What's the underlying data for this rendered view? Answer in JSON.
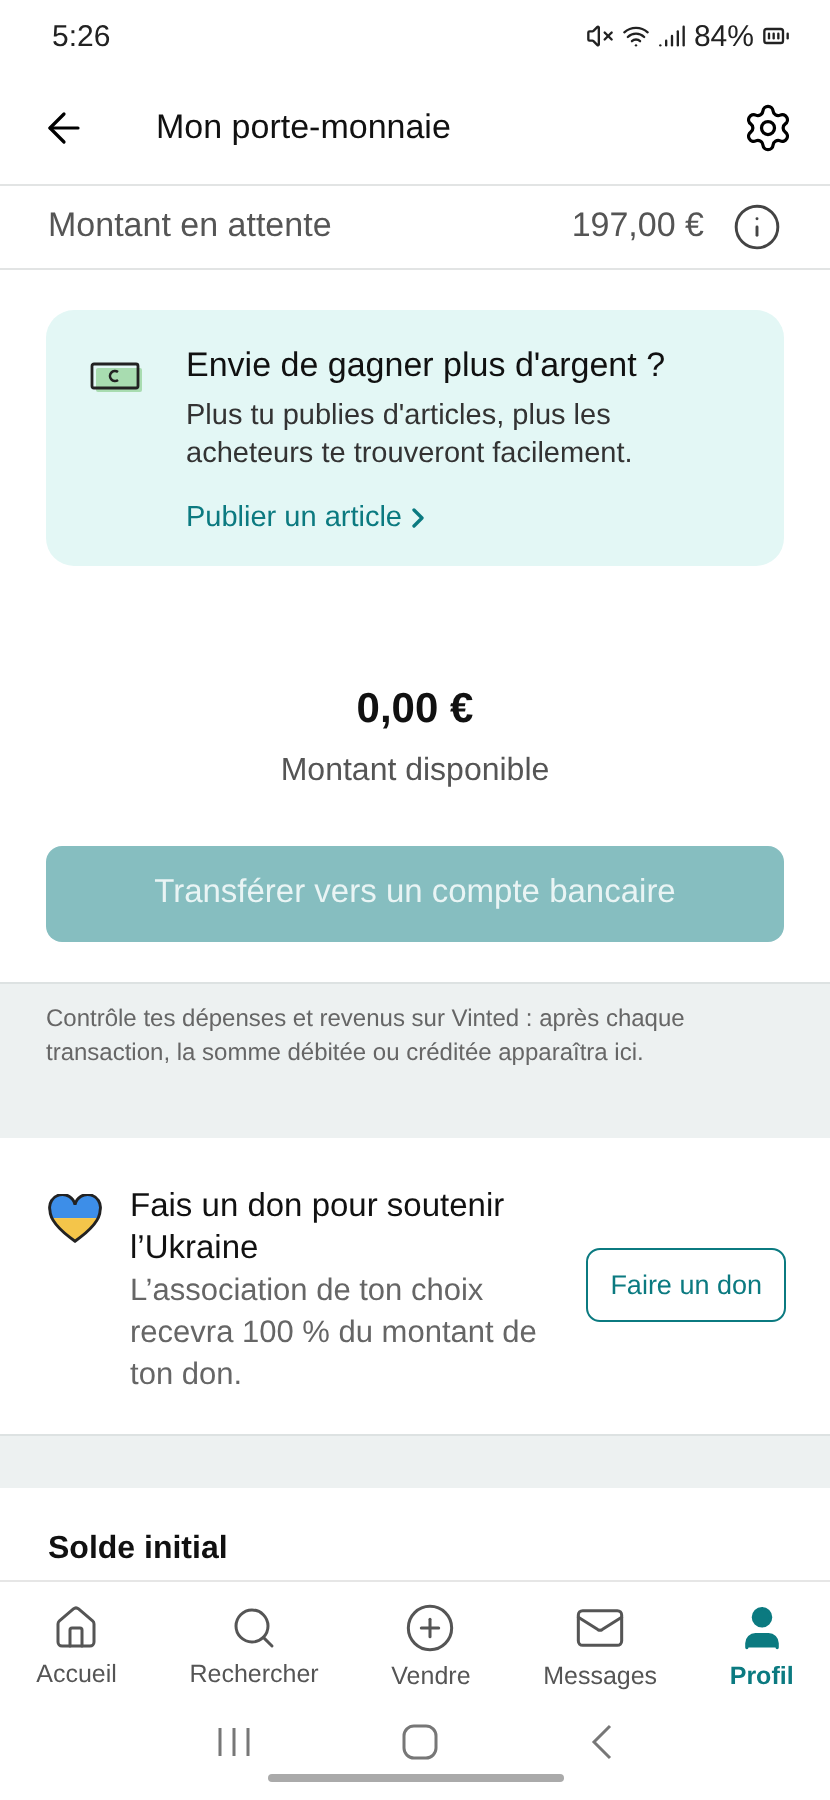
{
  "status_bar": {
    "time": "5:26",
    "battery": "84%"
  },
  "header": {
    "title": "Mon porte-monnaie"
  },
  "pending": {
    "label": "Montant en attente",
    "amount": "197,00 €"
  },
  "promo": {
    "title": "Envie de gagner plus d'argent ?",
    "text": "Plus tu publies d'articles, plus les acheteurs te trouveront facilement.",
    "link": "Publier un article"
  },
  "balance": {
    "amount": "0,00 €",
    "label": "Montant disponible"
  },
  "transfer_button": {
    "label": "Transférer vers un compte bancaire",
    "disabled": true
  },
  "info_text": "Contrôle tes dépenses et revenus sur Vinted : après chaque transaction, la somme débitée ou créditée apparaîtra ici.",
  "donation": {
    "title": "Fais un don pour soutenir l’Ukraine",
    "text": "L’association de ton choix recevra 100 % du montant de ton don.",
    "button": "Faire un don"
  },
  "history": {
    "title": "Solde initial"
  },
  "tabs": [
    {
      "label": "Accueil",
      "kind": "home",
      "selected": false
    },
    {
      "label": "Rechercher",
      "kind": "search",
      "selected": false
    },
    {
      "label": "Vendre",
      "kind": "sell",
      "selected": false
    },
    {
      "label": "Messages",
      "kind": "messages",
      "selected": false
    },
    {
      "label": "Profil",
      "kind": "profile",
      "selected": true
    }
  ]
}
